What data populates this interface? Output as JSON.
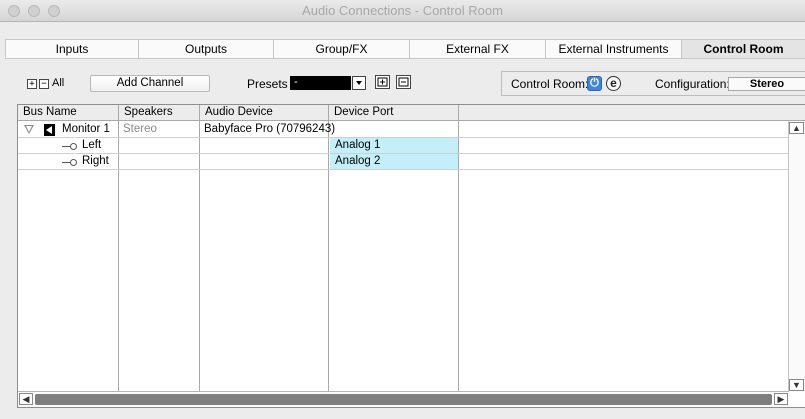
{
  "window": {
    "title": "Audio Connections - Control Room"
  },
  "tabs": [
    {
      "label": "Inputs",
      "active": false
    },
    {
      "label": "Outputs",
      "active": false
    },
    {
      "label": "Group/FX",
      "active": false
    },
    {
      "label": "External FX",
      "active": false
    },
    {
      "label": "External Instruments",
      "active": false
    },
    {
      "label": "Control Room",
      "active": true
    }
  ],
  "toolbar": {
    "all_label": "All",
    "expand_icon": "plus-box-icon",
    "collapse_icon": "minus-box-icon",
    "add_channel_label": "Add Channel",
    "presets_label": "Presets",
    "presets_value": "-",
    "control_room_label": "Control Room:",
    "configuration_label": "Configuration:",
    "configuration_value": "Stereo",
    "power_color": "#3d86dc"
  },
  "table": {
    "columns": [
      "Bus Name",
      "Speakers",
      "Audio Device",
      "Device Port",
      ""
    ],
    "rows": [
      {
        "bus_name": "Monitor 1",
        "speakers": "Stereo",
        "audio_device": "Babyface Pro (70796243)",
        "device_port": "",
        "level": 0
      },
      {
        "bus_name": "Left",
        "speakers": "",
        "audio_device": "",
        "device_port": "Analog 1",
        "level": 1
      },
      {
        "bus_name": "Right",
        "speakers": "",
        "audio_device": "",
        "device_port": "Analog 2",
        "level": 1
      }
    ],
    "port_highlight_color": "#c3effa"
  }
}
